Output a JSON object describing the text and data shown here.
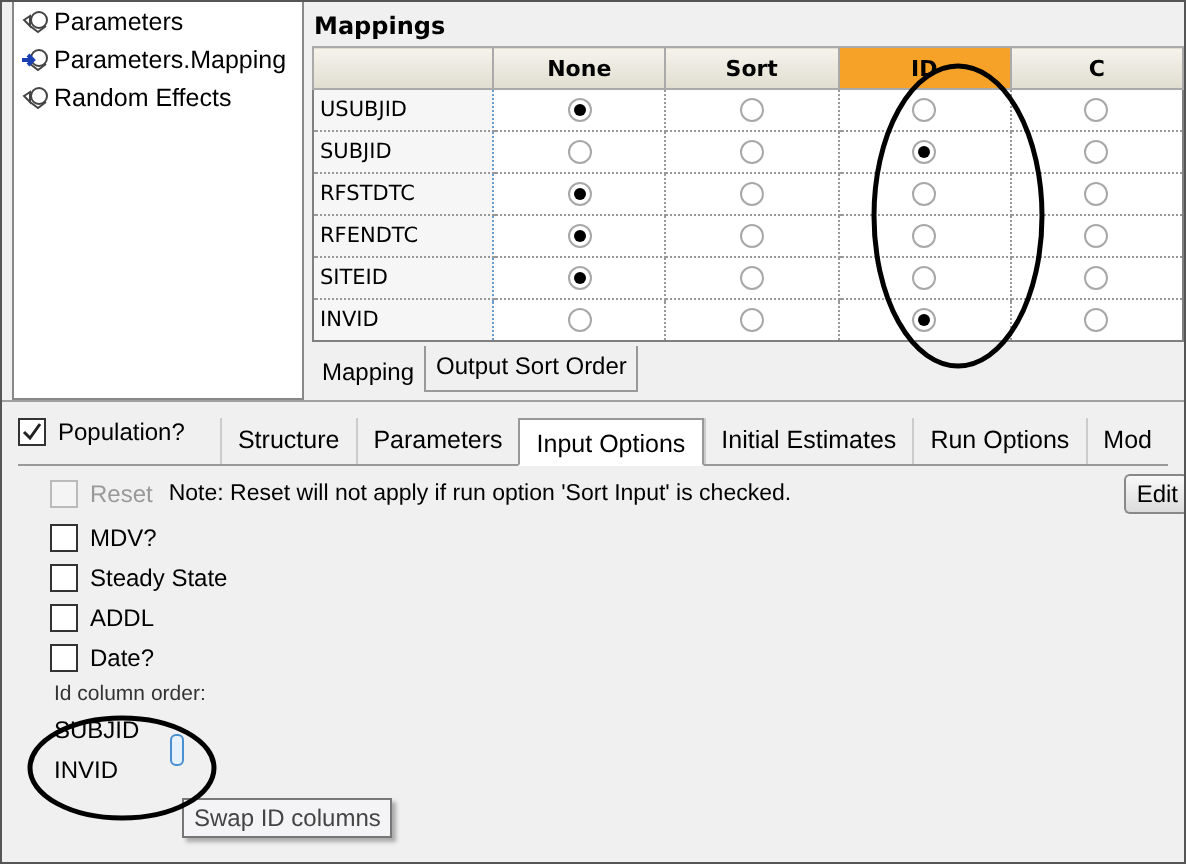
{
  "tree": {
    "items": [
      {
        "label": "Parameters",
        "current": false
      },
      {
        "label": "Parameters.Mapping",
        "current": true
      },
      {
        "label": "Random Effects",
        "current": false
      }
    ]
  },
  "mappings": {
    "title": "Mappings",
    "columns": [
      {
        "label": "None",
        "selected": false
      },
      {
        "label": "Sort",
        "selected": false
      },
      {
        "label": "ID",
        "selected": true
      },
      {
        "label": "C",
        "selected": false
      }
    ],
    "rows": [
      {
        "name": "USUBJID",
        "cells": [
          {
            "selected": true
          },
          {
            "selected": false
          },
          {
            "selected": false
          },
          {
            "selected": false
          }
        ]
      },
      {
        "name": "SUBJID",
        "cells": [
          {
            "selected": false
          },
          {
            "selected": false
          },
          {
            "selected": true
          },
          {
            "selected": false
          }
        ]
      },
      {
        "name": "RFSTDTC",
        "cells": [
          {
            "selected": true
          },
          {
            "selected": false
          },
          {
            "selected": false
          },
          {
            "selected": false
          }
        ]
      },
      {
        "name": "RFENDTC",
        "cells": [
          {
            "selected": true
          },
          {
            "selected": false
          },
          {
            "selected": false
          },
          {
            "selected": false
          }
        ]
      },
      {
        "name": "SITEID",
        "cells": [
          {
            "selected": true
          },
          {
            "selected": false
          },
          {
            "selected": false
          },
          {
            "selected": false
          }
        ]
      },
      {
        "name": "INVID",
        "cells": [
          {
            "selected": false
          },
          {
            "selected": false
          },
          {
            "selected": true
          },
          {
            "selected": false
          }
        ]
      }
    ],
    "tabs": [
      {
        "label": "Mapping",
        "selected": true
      },
      {
        "label": "Output Sort Order",
        "selected": false
      }
    ]
  },
  "population": {
    "label": "Population?",
    "checked": true
  },
  "tabs": [
    {
      "label": "Structure",
      "selected": false
    },
    {
      "label": "Parameters",
      "selected": false
    },
    {
      "label": "Input Options",
      "selected": true
    },
    {
      "label": "Initial Estimates",
      "selected": false
    },
    {
      "label": "Run Options",
      "selected": false
    },
    {
      "label": "Mod",
      "selected": false
    }
  ],
  "reset": {
    "label": "Reset",
    "checked": false,
    "disabled": true
  },
  "note": "Note: Reset will not apply if run option 'Sort Input' is checked.",
  "edit_button": "Edit",
  "options": [
    {
      "label": "MDV?",
      "checked": false
    },
    {
      "label": "Steady State",
      "checked": false
    },
    {
      "label": "ADDL",
      "checked": false
    },
    {
      "label": "Date?",
      "checked": false
    }
  ],
  "id_order": {
    "label": "Id column order:",
    "items": [
      "SUBJID",
      "INVID"
    ],
    "tooltip": "Swap ID columns"
  }
}
